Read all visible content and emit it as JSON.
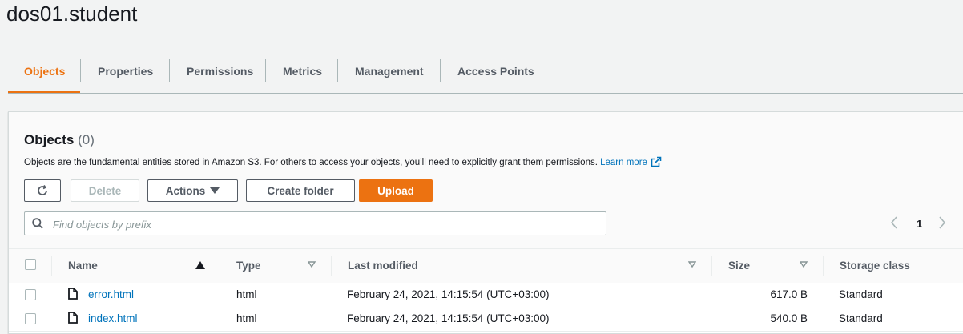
{
  "bucket": {
    "title": "dos01.student"
  },
  "tabs": [
    {
      "label": "Objects",
      "active": true
    },
    {
      "label": "Properties"
    },
    {
      "label": "Permissions"
    },
    {
      "label": "Metrics"
    },
    {
      "label": "Management"
    },
    {
      "label": "Access Points"
    }
  ],
  "objects": {
    "title": "Objects",
    "count": "(0)",
    "description": "Objects are the fundamental entities stored in Amazon S3. For others to access your objects, you’ll need to explicitly grant them permissions.",
    "learn_more": "Learn more"
  },
  "toolbar": {
    "refresh_icon": "refresh-icon",
    "delete_label": "Delete",
    "actions_label": "Actions",
    "create_folder_label": "Create folder",
    "upload_label": "Upload"
  },
  "search": {
    "placeholder": "Find objects by prefix",
    "value": ""
  },
  "pagination": {
    "page": "1"
  },
  "table": {
    "columns": [
      "Name",
      "Type",
      "Last modified",
      "Size",
      "Storage class"
    ],
    "rows": [
      {
        "name": "error.html",
        "type": "html",
        "last_modified": "February 24, 2021, 14:15:54 (UTC+03:00)",
        "size": "617.0 B",
        "storage_class": "Standard"
      },
      {
        "name": "index.html",
        "type": "html",
        "last_modified": "February 24, 2021, 14:15:54 (UTC+03:00)",
        "size": "540.0 B",
        "storage_class": "Standard"
      }
    ]
  },
  "colors": {
    "accent": "#ec7211",
    "link": "#0073bb",
    "text": "#16191f",
    "muted": "#545b64"
  }
}
